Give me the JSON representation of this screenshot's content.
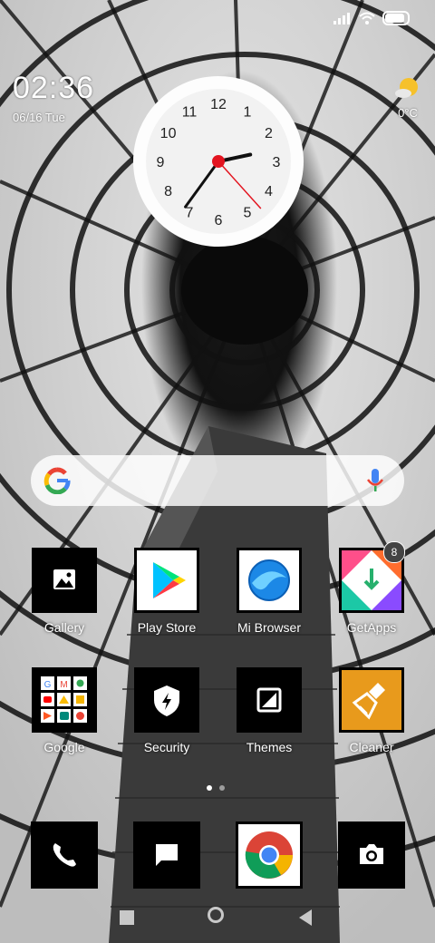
{
  "status_bar": {
    "signal_icon": "cellular-signal-icon",
    "wifi_icon": "wifi-icon",
    "battery_icon": "battery-icon",
    "battery_level": 0.8
  },
  "time_widget": {
    "time": "02:36",
    "date": "06/16 Tue"
  },
  "weather": {
    "icon": "partly-sunny-icon",
    "temp": "0°C"
  },
  "clock": {
    "numerals": [
      "12",
      "1",
      "2",
      "3",
      "4",
      "5",
      "6",
      "7",
      "8",
      "9",
      "10",
      "11"
    ],
    "hour": 2,
    "minute": 36,
    "second": 23,
    "face_color": "#f2f2f2",
    "accent": "#e3141f"
  },
  "search": {
    "google_icon": "google-g-icon",
    "mic_icon": "microphone-icon"
  },
  "apps_row1": [
    {
      "label": "Gallery",
      "icon": "gallery-icon"
    },
    {
      "label": "Play Store",
      "icon": "play-store-icon"
    },
    {
      "label": "Mi Browser",
      "icon": "mi-browser-icon"
    },
    {
      "label": "GetApps",
      "icon": "getapps-icon",
      "badge": "8"
    }
  ],
  "apps_row2": [
    {
      "label": "Google",
      "icon": "google-folder-icon"
    },
    {
      "label": "Security",
      "icon": "security-icon"
    },
    {
      "label": "Themes",
      "icon": "themes-icon"
    },
    {
      "label": "Cleaner",
      "icon": "cleaner-icon"
    }
  ],
  "dock": [
    {
      "icon": "phone-icon"
    },
    {
      "icon": "messages-icon"
    },
    {
      "icon": "chrome-icon"
    },
    {
      "icon": "camera-icon"
    }
  ],
  "nav": {
    "recents_icon": "recents-icon",
    "home_icon": "home-icon",
    "back_icon": "back-icon"
  },
  "colors": {
    "getapps_bg": "#ffffff",
    "cleaner_bg": "#e89a1c"
  }
}
